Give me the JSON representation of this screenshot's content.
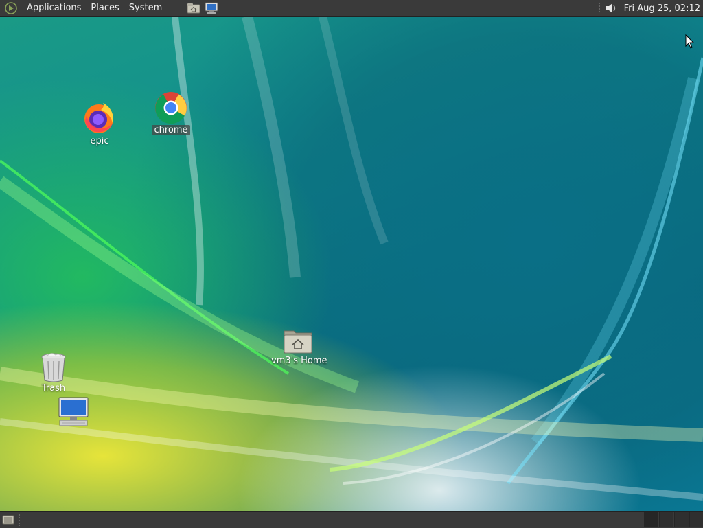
{
  "top_panel": {
    "menus": [
      "Applications",
      "Places",
      "System"
    ],
    "launchers": [
      "home-folder-icon",
      "computer-icon"
    ],
    "clock": "Fri Aug 25, 02:12",
    "volume_icon": "speaker-icon"
  },
  "desktop": {
    "icons": [
      {
        "label": "epic",
        "icon": "firefox-icon"
      },
      {
        "label": "chrome",
        "icon": "chrome-icon",
        "selected": true
      },
      {
        "label": "vm3's Home",
        "icon": "home-folder-icon"
      },
      {
        "label": "Trash",
        "icon": "trash-icon"
      },
      {
        "label": "",
        "icon": "computer-icon"
      }
    ]
  },
  "bottom_panel": {
    "show_desktop_icon": "show-desktop-icon",
    "workspaces": 4
  },
  "colors": {
    "panel_bg": "#3a3a3a",
    "panel_text": "#f0f0f0"
  }
}
